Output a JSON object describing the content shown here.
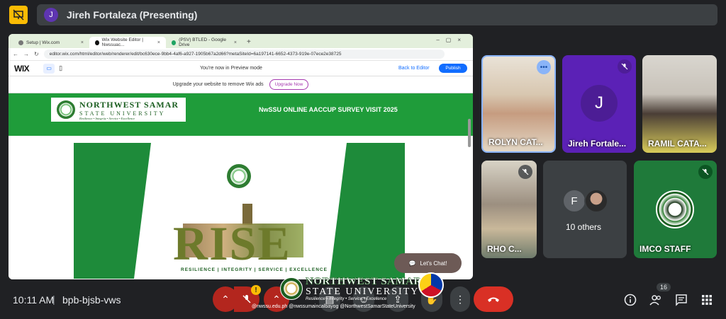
{
  "presenter": {
    "avatar_letter": "J",
    "label": "Jireh Fortaleza (Presenting)"
  },
  "browser": {
    "tabs": [
      {
        "label": "Setup | Wix.com"
      },
      {
        "label": "Wix Website Editor | Nwssuac..."
      },
      {
        "label": "(PSV) BTLED - Google Drive"
      }
    ],
    "new_tab": "+",
    "url": "editor.wix.com/html/editor/web/renderer/edit/bc630ece-9bb4-4af6-a927-1905b67a2d66?metaSiteId=6a197141-6652-4373-919e-07ece2e38725"
  },
  "wix": {
    "logo": "WIX",
    "preview_text": "You're now in Preview mode",
    "back_to_editor": "Back to Editor",
    "publish": "Publish",
    "upgrade_text": "Upgrade your website to remove Wix ads",
    "upgrade_button": "Upgrade Now"
  },
  "site": {
    "logo_line1": "NORTHWEST SAMAR",
    "logo_line2": "STATE UNIVERSITY",
    "logo_line3": "Resilience • Integrity • Service • Excellence",
    "title": "NwSSU ONLINE AACCUP SURVEY VISIT 2025",
    "hero_word": "RISE",
    "hero_motto": "RESILIENCE | INTEGRITY | SERVICE | EXCELLENCE",
    "chat_label": "Let's Chat!"
  },
  "participants": [
    {
      "name": "ROLYN CAT..."
    },
    {
      "name": "Jireh Fortale...",
      "avatar": "J"
    },
    {
      "name": "RAMIL CATA..."
    },
    {
      "name": "RHO C..."
    },
    {
      "others_label": "10 others",
      "avatar": "F"
    },
    {
      "name": "IMCO STAFF"
    }
  ],
  "bottom": {
    "time": "10:11 AM",
    "separator": "|",
    "meeting_code": "bpb-bjsb-vws",
    "people_count": "16",
    "overlay_line1": "NORTHWEST SAMAR",
    "overlay_line2": "STATE UNIVERSITY",
    "overlay_line3": "Resilience • Integrity • Service • Excellence",
    "social": "@nwssu.edu.ph  @nwssumaincalbayog  @NorthwestSamarStateUniversity",
    "warning": "!"
  },
  "colors": {
    "end_call": "#d93025",
    "muted_red": "#b3261e",
    "site_green": "#1f9c3a",
    "present_yellow": "#fbbc04"
  }
}
